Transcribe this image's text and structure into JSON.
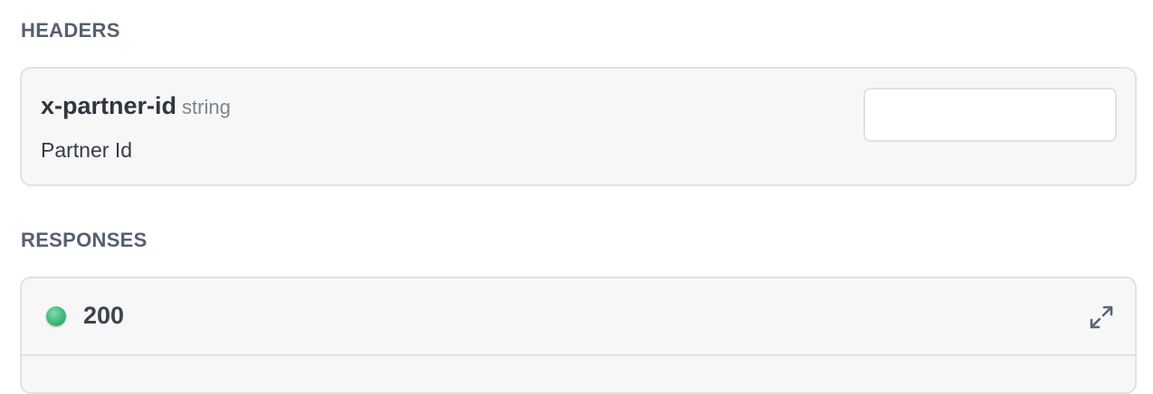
{
  "headers": {
    "title": "HEADERS",
    "params": [
      {
        "name": "x-partner-id",
        "type": "string",
        "description": "Partner Id",
        "value": ""
      }
    ]
  },
  "responses": {
    "title": "RESPONSES",
    "items": [
      {
        "code": "200",
        "status_color": "#3fb878",
        "icon": "expand-icon"
      }
    ]
  }
}
